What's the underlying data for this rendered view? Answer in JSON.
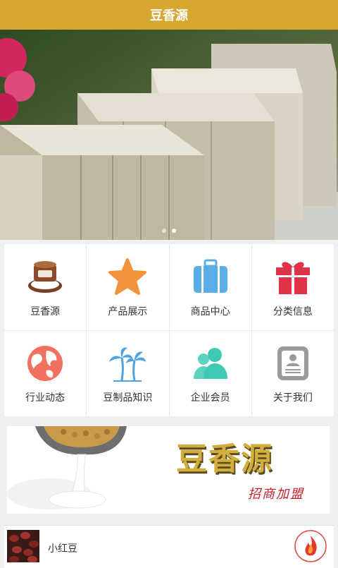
{
  "header": {
    "title": "豆香源"
  },
  "banner": {
    "slide_count": 2,
    "active_slide": 1
  },
  "grid": {
    "items": [
      {
        "label": "豆香源",
        "icon": "bowl-icon"
      },
      {
        "label": "产品展示",
        "icon": "star-icon"
      },
      {
        "label": "商品中心",
        "icon": "suitcase-icon"
      },
      {
        "label": "分类信息",
        "icon": "gift-icon"
      },
      {
        "label": "行业动态",
        "icon": "globe-icon"
      },
      {
        "label": "豆制品知识",
        "icon": "palm-tree-icon"
      },
      {
        "label": "企业会员",
        "icon": "users-icon"
      },
      {
        "label": "关于我们",
        "icon": "profile-card-icon"
      }
    ]
  },
  "promo": {
    "brand": "豆香源",
    "slogan": "招商加盟"
  },
  "product": {
    "name": "小红豆"
  },
  "colors": {
    "header": "#d6a731",
    "accent_star": "#f5923e",
    "suitcase": "#5aaee8",
    "gift": "#e03347",
    "globe": "#f0715f",
    "palm": "#4da3e0",
    "users": "#3ec9b3",
    "profile": "#9a9a9a"
  }
}
